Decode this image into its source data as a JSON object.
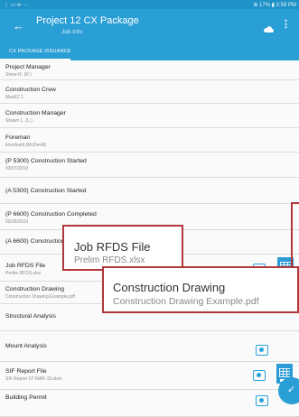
{
  "status_bar": {
    "left_icons": "⋮ ▭ ⊳ ···",
    "right_text": "⊚ 17% ▮ 2:59 PM"
  },
  "app_bar": {
    "title": "Project 12 CX Package",
    "subtitle": "Job Info",
    "back_icon": "arrow-left-icon",
    "cloud_icon": "cloud-icon",
    "menu_icon": "more-vert-icon"
  },
  "tabs": [
    {
      "label": "CX PACKAGE ISSUANCE",
      "active": true
    }
  ],
  "fields": [
    {
      "label": "Project Manager",
      "value": "Steve R. (R.)"
    },
    {
      "label": "Construction Crew",
      "value": "MasEZ 1"
    },
    {
      "label": "Construction Manager",
      "value": "Shawn L. (L.)"
    },
    {
      "label": "Foreman",
      "value": "kmcdevitt (McDevitt)"
    },
    {
      "label": "(P 5300) Construction Started",
      "value": "03/07/2019"
    },
    {
      "label": "(A 5300) Construction Started",
      "value": ""
    },
    {
      "label": "(P 6600) Construction Completed",
      "value": "03/26/2019"
    },
    {
      "label": "(A 6600) Construction",
      "value": ""
    },
    {
      "label": "Job RFDS File",
      "value": "Prelim RFDS.xlsx"
    },
    {
      "label": "Construction Drawing",
      "value": "Construction Drawing Example.pdf"
    },
    {
      "label": "Structural Analysis",
      "value": ""
    },
    {
      "label": "Mount Analysis",
      "value": ""
    },
    {
      "label": "SIF Report File",
      "value": "SIF Report 07-MAR-19.xlsm"
    },
    {
      "label": "Building Permit",
      "value": ""
    }
  ],
  "callouts": [
    {
      "title": "Job RFDS File",
      "filename": "Prelim RFDS.xlsx"
    },
    {
      "title": "Construction Drawing",
      "filename": "Construction Drawing Example.pdf"
    }
  ],
  "fab_icon": "check-icon",
  "colors": {
    "primary": "#2a9fd6",
    "callout_border": "#b2373a",
    "file_icon": "#29a3dc"
  }
}
